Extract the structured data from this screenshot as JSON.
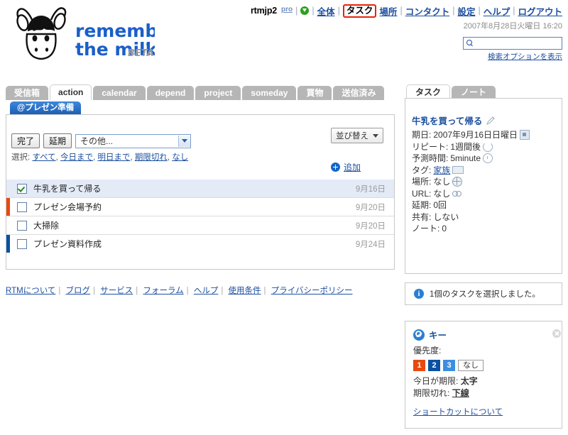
{
  "brand": {
    "name_line1": "remember",
    "name_line2": "the milk",
    "tm": "™",
    "beta": "BETA"
  },
  "topnav": {
    "user": "rtmjp2",
    "pro_badge": "pro",
    "status_icon": "green-arrow-icon",
    "items": [
      {
        "label": "全体",
        "active": false
      },
      {
        "label": "タスク",
        "active": true
      },
      {
        "label": "場所",
        "active": false
      },
      {
        "label": "コンタクト",
        "active": false
      },
      {
        "label": "設定",
        "active": false
      },
      {
        "label": "ヘルプ",
        "active": false
      },
      {
        "label": "ログアウト",
        "active": false
      }
    ],
    "separator": "|"
  },
  "datetime": "2007年8月28日火曜日  16:20",
  "search": {
    "value": "",
    "placeholder": "",
    "icon": "search-icon",
    "options_link": "検索オプションを表示"
  },
  "tabs": [
    {
      "label": "受信箱",
      "active": false
    },
    {
      "label": "action",
      "active": true
    },
    {
      "label": "calendar",
      "active": false
    },
    {
      "label": "depend",
      "active": false
    },
    {
      "label": "project",
      "active": false
    },
    {
      "label": "someday",
      "active": false
    },
    {
      "label": "買物",
      "active": false
    },
    {
      "label": "送信済み",
      "active": false
    }
  ],
  "subtabs": [
    {
      "label": "@プレゼン準備",
      "active": true
    }
  ],
  "toolbar": {
    "complete_label": "完了",
    "postpone_label": "延期",
    "more_select": "その他...",
    "sort_label": "並び替え",
    "add_label": "追加",
    "select_prefix": "選択:",
    "select_links": [
      "すべて",
      "今日まで",
      "明日まで",
      "期限切れ",
      "なし"
    ]
  },
  "tasks": [
    {
      "name": "牛乳を買って帰る",
      "date": "9月16日",
      "checked": true,
      "selected": true,
      "priority_color": "none"
    },
    {
      "name": "プレゼン会場予約",
      "date": "9月20日",
      "checked": false,
      "selected": false,
      "priority_color": "#e8490f"
    },
    {
      "name": "大掃除",
      "date": "9月20日",
      "checked": false,
      "selected": false,
      "priority_color": "none"
    },
    {
      "name": "プレゼン資料作成",
      "date": "9月24日",
      "checked": false,
      "selected": false,
      "priority_color": "#0a51a1"
    }
  ],
  "footer_links": [
    "RTMについて",
    "ブログ",
    "サービス",
    "フォーラム",
    "ヘルプ",
    "使用条件",
    "プライバシーポリシー"
  ],
  "right_tabs": [
    {
      "label": "タスク",
      "active": true
    },
    {
      "label": "ノート",
      "active": false
    }
  ],
  "detail": {
    "title": "牛乳を買って帰る",
    "edit_icon": "pencil-icon",
    "fields": [
      {
        "label": "期日:",
        "value": "2007年9月16日日曜日",
        "icon": "calendar-icon",
        "link": false
      },
      {
        "label": "リピート:",
        "value": "1週間後",
        "icon": "repeat-icon",
        "link": false
      },
      {
        "label": "予測時間:",
        "value": "5minute",
        "icon": "clock-icon",
        "link": false
      },
      {
        "label": "タグ:",
        "value": "家族",
        "icon": "tag-icon",
        "link": true
      },
      {
        "label": "場所:",
        "value": "なし",
        "icon": "globe-icon",
        "link": false
      },
      {
        "label": "URL:",
        "value": "なし",
        "icon": "link-icon",
        "link": false
      },
      {
        "label": "延期:",
        "value": "0回",
        "icon": "",
        "link": false
      },
      {
        "label": "共有:",
        "value": "しない",
        "icon": "",
        "link": false
      },
      {
        "label": "ノート:",
        "value": "0",
        "icon": "",
        "link": false
      }
    ]
  },
  "info": {
    "icon": "info-icon",
    "message": "1個のタスクを選択しました。"
  },
  "key_panel": {
    "icon": "key-icon",
    "title": "キー",
    "close_icon": "close-icon",
    "priority_label": "優先度:",
    "priorities": [
      {
        "label": "1",
        "color": "#e8490f"
      },
      {
        "label": "2",
        "color": "#0a51a1"
      },
      {
        "label": "3",
        "color": "#3c8fe0"
      }
    ],
    "none_label": "なし",
    "due_today_label": "今日が期限:",
    "due_today_value": "太字",
    "overdue_label": "期限切れ:",
    "overdue_value": "下線",
    "shortcut_link": "ショートカットについて"
  },
  "colors": {
    "link": "#1d4fa0",
    "tab_inactive": "#b6b6b6",
    "subtab": "#2069c4",
    "annotation": "#e8210a"
  }
}
